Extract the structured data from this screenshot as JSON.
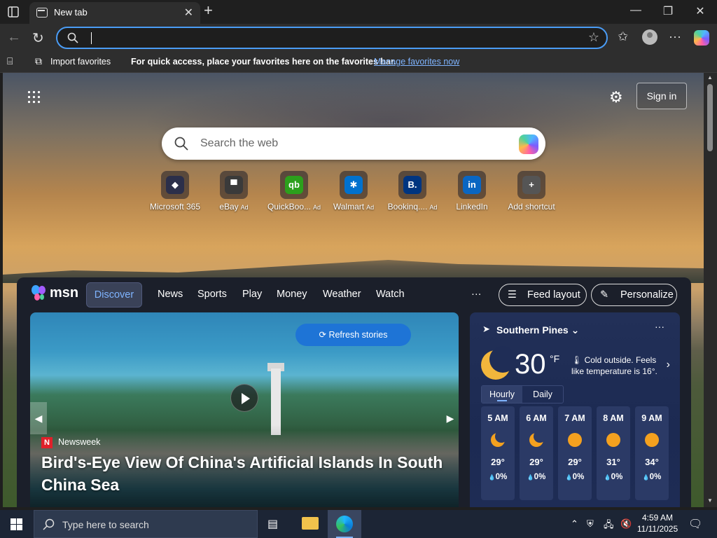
{
  "browser": {
    "tab_title": "New tab",
    "favorites_bar": {
      "import_label": "Import favorites",
      "hint": "For quick access, place your favorites here on the favorites bar.",
      "manage_link": "Manage favorites now"
    }
  },
  "newtab": {
    "sign_in": "Sign in",
    "search_placeholder": "Search the web",
    "shortcuts": [
      {
        "label": "Microsoft 365",
        "ad": "",
        "icon": "microsoft365-icon",
        "color": "#2b2f4a",
        "glyph": "◆"
      },
      {
        "label": "eBay",
        "ad": "Ad",
        "icon": "ebay-icon",
        "color": "#3a3a3a",
        "glyph": "▀"
      },
      {
        "label": "QuickBoo...",
        "ad": "Ad",
        "icon": "quickbooks-icon",
        "color": "#2ca01c",
        "glyph": "qb"
      },
      {
        "label": "Walmart",
        "ad": "Ad",
        "icon": "walmart-icon",
        "color": "#0071ce",
        "glyph": "✱"
      },
      {
        "label": "Bookinq....",
        "ad": "Ad",
        "icon": "booking-icon",
        "color": "#003580",
        "glyph": "B."
      },
      {
        "label": "LinkedIn",
        "ad": "",
        "icon": "linkedin-icon",
        "color": "#0a66c2",
        "glyph": "in"
      },
      {
        "label": "Add shortcut",
        "ad": "",
        "icon": "add-icon",
        "color": "#555555",
        "glyph": "+"
      }
    ]
  },
  "msn": {
    "brand": "msn",
    "nav": [
      "Discover",
      "News",
      "Sports",
      "Play",
      "Money",
      "Weather",
      "Watch"
    ],
    "more": "···",
    "feed_layout": "Feed layout",
    "personalize": "Personalize",
    "hero": {
      "refresh_label": "Refresh stories",
      "source": "Newsweek",
      "headline": "Bird's-Eye View Of China's Artificial Islands In South China Sea"
    },
    "weather": {
      "location": "Southern Pines",
      "temp": "30",
      "unit": "°F",
      "note": "Cold outside. Feels like temperature is 16°.",
      "tabs": [
        "Hourly",
        "Daily"
      ],
      "hours": [
        {
          "time": "5 AM",
          "temp": "29°",
          "precip": "0%",
          "icon": "moon-icon"
        },
        {
          "time": "6 AM",
          "temp": "29°",
          "precip": "0%",
          "icon": "moon-icon"
        },
        {
          "time": "7 AM",
          "temp": "29°",
          "precip": "0%",
          "icon": "sun-icon"
        },
        {
          "time": "8 AM",
          "temp": "31°",
          "precip": "0%",
          "icon": "sun-icon"
        },
        {
          "time": "9 AM",
          "temp": "34°",
          "precip": "0%",
          "icon": "sun-icon"
        }
      ]
    }
  },
  "taskbar": {
    "search_placeholder": "Type here to search",
    "time": "4:59 AM",
    "date": "11/11/2025"
  },
  "colors": {
    "accent": "#4a9cf5",
    "refresh_button": "#1e74d6",
    "discover_text": "#7fb4ff"
  }
}
